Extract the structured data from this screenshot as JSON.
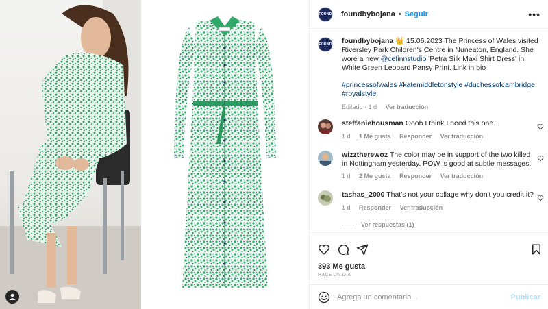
{
  "header": {
    "avatar_text": "FOUND",
    "username": "foundbybojana",
    "separator": "•",
    "follow_label": "Seguir",
    "more_label": "•••"
  },
  "caption": {
    "username": "foundbybojana",
    "crown": "👑",
    "text_part1": " 15.06.2023 The Princess of Wales visited Riversley Park Children's Centre in Nuneaton, England. She wore a new ",
    "mention": "@cefinnstudio",
    "text_part2": " 'Petra Silk Maxi Shirt Dress' in White Green Leopard Pansy Print. Link in bio",
    "hashtags": "#princessofwales #katemiddletonstyle #duchessofcambridge #royalstyle",
    "edited": "Editado · 1 d",
    "see_translation": "Ver traducción"
  },
  "comments": [
    {
      "username": "steffaniehousman",
      "text": "Oooh I think I need this one.",
      "time": "1 d",
      "likes": "1 Me gusta",
      "reply": "Responder",
      "translate": "Ver traducción"
    },
    {
      "username": "wizztherewoz",
      "text": "The color may be in support of the two killed in Nottingham yesterday. POW is good at subtle messages.",
      "time": "1 d",
      "likes": "2 Me gusta",
      "reply": "Responder",
      "translate": "Ver traducción"
    },
    {
      "username": "tashas_2000",
      "text": "That's not your collage why don't you credit it?",
      "time": "1 d",
      "reply": "Responder",
      "translate": "Ver traducción",
      "view_replies": "Ver respuestas (1)"
    }
  ],
  "stats": {
    "likes": "393 Me gusta",
    "time": "HACE UN DÍA"
  },
  "add_comment": {
    "placeholder": "Agrega un comentario...",
    "publish": "Publicar"
  },
  "colors": {
    "accent": "#0095f6",
    "link": "#00376b",
    "muted": "#8e8e8e",
    "publish_disabled": "#b2dffc",
    "dress_green": "#2fa86a",
    "avatar_navy": "#1f2a5c"
  },
  "icons": [
    "user-tag-icon",
    "more-icon",
    "heart-icon",
    "comment-icon",
    "share-icon",
    "bookmark-icon",
    "emoji-icon"
  ]
}
